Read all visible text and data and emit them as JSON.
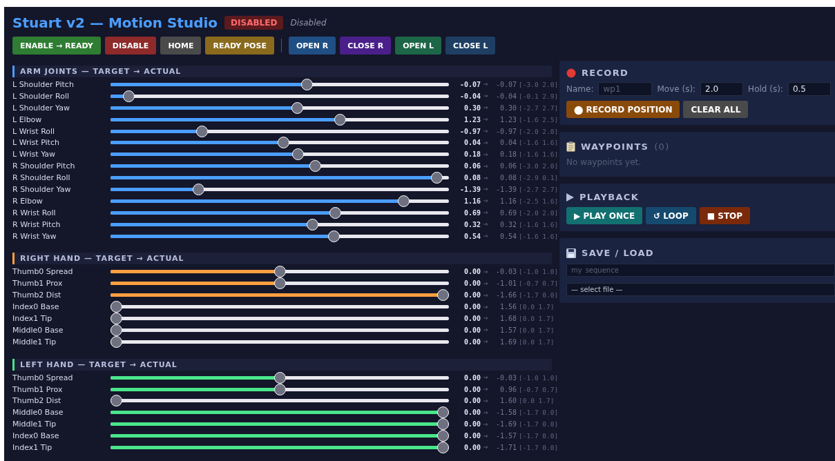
{
  "title": "Stuart v2 — Motion Studio",
  "status_badge": "DISABLED",
  "status_text": "Disabled",
  "buttons": [
    {
      "label": "ENABLE → READY",
      "color": "#2e7d32"
    },
    {
      "label": "DISABLE",
      "color": "#8e2a2a"
    },
    {
      "label": "HOME",
      "color": "#4a4a4a"
    },
    {
      "label": "READY POSE",
      "color": "#8a6a1c"
    },
    {
      "label": "OPEN R",
      "color": "#1f4f84"
    },
    {
      "label": "CLOSE R",
      "color": "#4a1f8a"
    },
    {
      "label": "OPEN L",
      "color": "#1d6647"
    },
    {
      "label": "CLOSE L",
      "color": "#1e3f63"
    }
  ],
  "sections": [
    {
      "title": "ARM JOINTS — TARGET → ACTUAL",
      "color": "#4a9eff",
      "joints": [
        {
          "name": "L Shoulder Pitch",
          "level": 0.584,
          "target": "-0.07",
          "actual": "-0.07",
          "range": "[-3.0 2.0]"
        },
        {
          "name": "L Shoulder Roll",
          "level": 0.037,
          "target": "-0.04",
          "actual": "-0.04",
          "range": "[-0.1 2.9]"
        },
        {
          "name": "L Shoulder Yaw",
          "level": 0.553,
          "target": "0.30",
          "actual": "0.30",
          "range": "[-2.7 2.7]"
        },
        {
          "name": "L Elbow",
          "level": 0.684,
          "target": "1.23",
          "actual": "1.23",
          "range": "[-1.6 2.5]"
        },
        {
          "name": "L Wrist Roll",
          "level": 0.262,
          "target": "-0.97",
          "actual": "-0.97",
          "range": "[-2.0 2.0]"
        },
        {
          "name": "L Wrist Pitch",
          "level": 0.512,
          "target": "0.04",
          "actual": "0.04",
          "range": "[-1.6 1.6]"
        },
        {
          "name": "L Wrist Yaw",
          "level": 0.556,
          "target": "0.18",
          "actual": "0.18",
          "range": "[-1.6 1.6]"
        },
        {
          "name": "R Shoulder Pitch",
          "level": 0.609,
          "target": "0.06",
          "actual": "0.06",
          "range": "[-3.0 2.0]"
        },
        {
          "name": "R Shoulder Roll",
          "level": 0.98,
          "target": "0.08",
          "actual": "0.08",
          "range": "[-2.9 0.1]"
        },
        {
          "name": "R Shoulder Yaw",
          "level": 0.252,
          "target": "-1.39",
          "actual": "-1.39",
          "range": "[-2.7 2.7]"
        },
        {
          "name": "R Elbow",
          "level": 0.88,
          "target": "1.16",
          "actual": "1.16",
          "range": "[-2.5 1.6]"
        },
        {
          "name": "R Wrist Roll",
          "level": 0.67,
          "target": "0.69",
          "actual": "0.69",
          "range": "[-2.0 2.0]"
        },
        {
          "name": "R Wrist Pitch",
          "level": 0.6,
          "target": "0.32",
          "actual": "0.32",
          "range": "[-1.6 1.6]"
        },
        {
          "name": "R Wrist Yaw",
          "level": 0.667,
          "target": "0.54",
          "actual": "0.54",
          "range": "[-1.6 1.6]"
        }
      ]
    },
    {
      "title": "RIGHT HAND — TARGET → ACTUAL",
      "color": "#ff9f40",
      "joints": [
        {
          "name": "Thumb0 Spread",
          "level": 0.5,
          "target": "0.00",
          "actual": "-0.03",
          "range": "[-1.0 1.0]"
        },
        {
          "name": "Thumb1 Prox",
          "level": 0.5,
          "target": "0.00",
          "actual": "-1.01",
          "range": "[-0.7 0.7]"
        },
        {
          "name": "Thumb2 Dist",
          "level": 1,
          "target": "0.00",
          "actual": "-1.66",
          "range": "[-1.7 0.0]"
        },
        {
          "name": "Index0 Base",
          "level": 0,
          "target": "0.00",
          "actual": "1.56",
          "range": "[0.0 1.7]"
        },
        {
          "name": "Index1 Tip",
          "level": 0,
          "target": "0.00",
          "actual": "1.68",
          "range": "[0.0 1.7]"
        },
        {
          "name": "Middle0 Base",
          "level": 0,
          "target": "0.00",
          "actual": "1.57",
          "range": "[0.0 1.7]"
        },
        {
          "name": "Middle1 Tip",
          "level": 0,
          "target": "0.00",
          "actual": "1.69",
          "range": "[0.0 1.7]"
        }
      ]
    },
    {
      "title": "LEFT HAND — TARGET → ACTUAL",
      "color": "#4ae68a",
      "joints": [
        {
          "name": "Thumb0 Spread",
          "level": 0.5,
          "target": "0.00",
          "actual": "-0.03",
          "range": "[-1.0 1.0]"
        },
        {
          "name": "Thumb1 Prox",
          "level": 0.5,
          "target": "0.00",
          "actual": "0.96",
          "range": "[-0.7 0.7]"
        },
        {
          "name": "Thumb2 Dist",
          "level": 0,
          "target": "0.00",
          "actual": "1.60",
          "range": "[0.0 1.7]"
        },
        {
          "name": "Middle0 Base",
          "level": 1,
          "target": "0.00",
          "actual": "-1.58",
          "range": "[-1.7 0.0]"
        },
        {
          "name": "Middle1 Tip",
          "level": 1,
          "target": "0.00",
          "actual": "-1.69",
          "range": "[-1.7 0.0]"
        },
        {
          "name": "Index0 Base",
          "level": 1,
          "target": "0.00",
          "actual": "-1.57",
          "range": "[-1.7 0.0]"
        },
        {
          "name": "Index1 Tip",
          "level": 1,
          "target": "0.00",
          "actual": "-1.71",
          "range": "[-1.7 0.0]"
        }
      ]
    }
  ],
  "record": {
    "title": "RECORD",
    "name_label": "Name:",
    "name_placeholder": "wp1",
    "move_label": "Move (s):",
    "move_value": "2.0",
    "hold_label": "Hold (s):",
    "hold_value": "0.5",
    "buttons": [
      {
        "label": "⬤ RECORD POSITION",
        "color": "#8a4a0a"
      },
      {
        "label": "CLEAR ALL",
        "color": "#4a4a4a"
      }
    ]
  },
  "waypoints": {
    "title": "WAYPOINTS",
    "count": "(0)",
    "empty_text": "No waypoints yet."
  },
  "playback": {
    "title": "PLAYBACK",
    "buttons": [
      {
        "label": "▶ PLAY ONCE",
        "color": "#137070"
      },
      {
        "label": "↺ LOOP",
        "color": "#154a6e"
      },
      {
        "label": "■ STOP",
        "color": "#7a2a0a"
      }
    ]
  },
  "save_load": {
    "title": "SAVE / LOAD",
    "filename_placeholder": "my_sequence",
    "file_option": "— select file —"
  }
}
